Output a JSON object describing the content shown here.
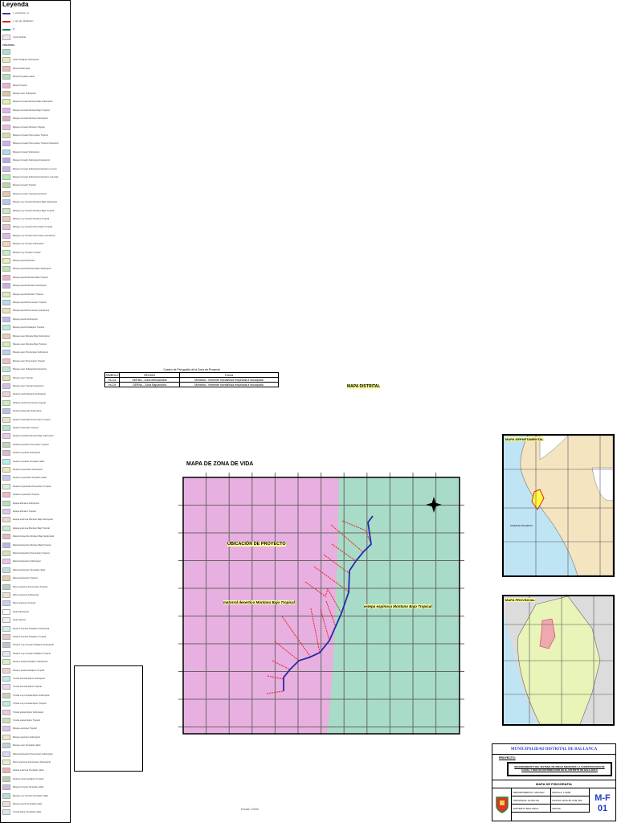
{
  "legend": {
    "title": "Leyenda",
    "lines": [
      {
        "label": "L_conduccion_xx",
        "color": "#3a3aa8",
        "style": "solid"
      },
      {
        "label": "L_red_de_distribucion",
        "color": "#e82020",
        "style": "dashed"
      },
      {
        "label": "R",
        "color": "#1a8a5a",
        "style": "solid"
      },
      {
        "label": "Limite distrital",
        "color": "#f8e0f8",
        "style": "box"
      }
    ],
    "section": "ZONAVIDA",
    "items": [
      [
        "",
        "#a8e0d0"
      ],
      [
        "Arido Subalpino Subtropical",
        "#e8ecb0"
      ],
      [
        "Boreal Subtropical",
        "#f0b8b0"
      ],
      [
        "Boreal Templado calido",
        "#b0e0c0"
      ],
      [
        "Boreal Tropical",
        "#f0b0d8"
      ],
      [
        "Bosque seco Subtropical",
        "#d8c8a0"
      ],
      [
        "Bosque humedo Montano Bajo Subtropical",
        "#e0f0a8"
      ],
      [
        "Bosque humedo Montano Bajo Tropical",
        "#e8b0f0"
      ],
      [
        "Bosque humedo Montano Subtropical",
        "#d8b0c0"
      ],
      [
        "Bosque humedo Montano Tropical",
        "#f0b8e0"
      ],
      [
        "Bosque humedo Premontano Tropical",
        "#d8e0a0"
      ],
      [
        "Bosque humedo Premontano Tropical (transicion)",
        "#c8b0f0"
      ],
      [
        "Bosque humedo Subtropical",
        "#b0d8e8"
      ],
      [
        "Bosque humedo Subtropical (transicion)",
        "#b8a8f0"
      ],
      [
        "Bosque humedo Subtropical (transicion a seco)",
        "#d0b0f0"
      ],
      [
        "Bosque humedo Subtropical (transicion a pluvial)",
        "#b0f0b0"
      ],
      [
        "Bosque humedo Tropical",
        "#b8d8a0"
      ],
      [
        "Bosque humedo Tropical (transicion)",
        "#e0c8b0"
      ],
      [
        "Bosque muy humedo Montano Bajo Subtropical",
        "#b0c8f0"
      ],
      [
        "Bosque muy humedo Montano Bajo Tropical",
        "#c8e8c0"
      ],
      [
        "Bosque muy humedo Montano Tropical",
        "#f0c8b0"
      ],
      [
        "Bosque muy humedo Premontano Tropical",
        "#e8c0d8"
      ],
      [
        "Bosque muy humedo Premontano (transicion)",
        "#e0b8f0"
      ],
      [
        "Bosque muy humedo Subtropical",
        "#f0d8b0"
      ],
      [
        "Bosque muy humedo Tropical",
        "#c0f0c8"
      ],
      [
        "Bosque pluvial Montano",
        "#e8f0b0"
      ],
      [
        "Bosque pluvial Montano Bajo Subtropical",
        "#b8e8b0"
      ],
      [
        "Bosque pluvial Montano Bajo Tropical",
        "#f0b0c8"
      ],
      [
        "Bosque pluvial Montano Subtropical",
        "#c8b0e8"
      ],
      [
        "Bosque pluvial Montano Tropical",
        "#d8f0b0"
      ],
      [
        "Bosque pluvial Premontano Tropical",
        "#b0e0f0"
      ],
      [
        "Bosque pluvial Premontano (transicion)",
        "#f0e0b0"
      ],
      [
        "Bosque pluvial Subtropical",
        "#c0b8f0"
      ],
      [
        "Bosque pluvial Subalpino Tropical",
        "#b0f0e0"
      ],
      [
        "Bosque seco Montano Bajo Subtropical",
        "#e8d0b8"
      ],
      [
        "Bosque seco Montano Bajo Tropical",
        "#d0f0b8"
      ],
      [
        "Bosque seco Premontano Subtropical",
        "#b8d0f0"
      ],
      [
        "Bosque seco Premontano Tropical",
        "#f0c0c0"
      ],
      [
        "Bosque seco Subtropical (transicion)",
        "#c0e8d8"
      ],
      [
        "Bosque seco Tropical",
        "#e0e0b0"
      ],
      [
        "Bosque seco Tropical (transicion)",
        "#d0c0e8"
      ],
      [
        "Desierto arido Montano Subtropical",
        "#f0d0e0"
      ],
      [
        "Desierto arido Premontano Tropical",
        "#c8f0b0"
      ],
      [
        "Desierto desecado Subtropical",
        "#b8c0e8"
      ],
      [
        "Desierto desecado Premontano Tropical",
        "#e8e8c0"
      ],
      [
        "Desierto desecado Tropical",
        "#b0e8c8"
      ],
      [
        "Desierto perarido Montano Bajo Subtropical",
        "#f0c8e8"
      ],
      [
        "Desierto perarido Premontano Tropical",
        "#c0d8b0"
      ],
      [
        "Desierto perarido Subtropical",
        "#d8b8d0"
      ],
      [
        "Desierto perarido Templado calido",
        "#b0f0f0"
      ],
      [
        "Desierto superarido Subtropical",
        "#f0e8b0"
      ],
      [
        "Desierto superarido Templado calido",
        "#c8c8f0"
      ],
      [
        "Desierto superarido Premontano Tropical",
        "#e0f0d0"
      ],
      [
        "Desierto superarido Tropical",
        "#f0b8c0"
      ],
      [
        "Estepa Montano Subtropical",
        "#b8e0b8"
      ],
      [
        "Estepa Montano Tropical",
        "#d8c8f0"
      ],
      [
        "Estepa espinosa Montano Bajo Subtropical",
        "#f0d8c8"
      ],
      [
        "Estepa espinosa Montano Bajo Tropical",
        "#c0f0d0"
      ],
      [
        "Matorral desertico Montano Bajo Subtropical",
        "#e8b8b8"
      ],
      [
        "Matorral desertico Montano Bajo Tropical",
        "#b8b8e8"
      ],
      [
        "Matorral desertico Premontano Tropical",
        "#d0e8b0"
      ],
      [
        "Matorral desertico Subtropical",
        "#f0c0f0"
      ],
      [
        "Matorral desertico Templado calido",
        "#c0e0e0"
      ],
      [
        "Matorral desertico Tropical",
        "#e0d0b0"
      ],
      [
        "Monte espinoso Premontano Tropical",
        "#b0d0c0"
      ],
      [
        "Monte espinoso Subtropical",
        "#f0e0d0"
      ],
      [
        "Monte espinoso Tropical",
        "#c8d0f0"
      ],
      [
        "Nival Subtropical",
        "#ffffff"
      ],
      [
        "Nival Tropical",
        "#f0f0f0"
      ],
      [
        "Paramo humedo Subalpino Subtropical",
        "#d0f0e8"
      ],
      [
        "Paramo humedo Subalpino Tropical",
        "#e8c8c8"
      ],
      [
        "Paramo muy humedo Subalpino Subtropical",
        "#c0c0d8"
      ],
      [
        "Paramo muy humedo Subalpino Tropical",
        "#e0e8f0"
      ],
      [
        "Paramo pluvial Subalpino Subtropical",
        "#d8f0c0"
      ],
      [
        "Paramo pluvial Subalpino Tropical",
        "#f0d0d0"
      ],
      [
        "Tundra humeda Alpino Subtropical",
        "#c0e8f0"
      ],
      [
        "Tundra humeda Alpino Tropical",
        "#e8d8f0"
      ],
      [
        "Tundra muy humeda Alpino Subtropical",
        "#d0d0b8"
      ],
      [
        "Tundra muy humeda Alpino Tropical",
        "#b8f0d8"
      ],
      [
        "Tundra pluvial Alpino Subtropical",
        "#f0c8d8"
      ],
      [
        "Tundra pluvial Alpino Tropical",
        "#c8e0b8"
      ],
      [
        "Bosque espinoso Tropical",
        "#e0c0f0"
      ],
      [
        "Bosque espinoso Subtropical",
        "#f0e8c8"
      ],
      [
        "Bosque seco Templado calido",
        "#b8d8d8"
      ],
      [
        "Matorral desertico Premontano Subtropical",
        "#d8d8f0"
      ],
      [
        "Monte espinoso Premontano Subtropical",
        "#e8f0c8"
      ],
      [
        "Estepa espinosa Templado calido",
        "#f0b0b0"
      ],
      [
        "Desierto arido Subalpino Tropical",
        "#c0c8b0"
      ],
      [
        "Bosque humedo Templado calido",
        "#d0b8e0"
      ],
      [
        "Bosque muy humedo Templado calido",
        "#b0e0d8"
      ],
      [
        "Bosque pluvial Templado calido",
        "#e8e0d8"
      ],
      [
        "Tundra Alpino Templado calido",
        "#d8e8e8"
      ]
    ]
  },
  "table": {
    "caption": "Cuadro de Fisiografia de la Zona de Proyecto",
    "headers": [
      "SIMBOLO",
      "REGION",
      "Forma"
    ],
    "rows": [
      [
        "Vs-Ca",
        "SERNA - Zona Mesoandina",
        "Montaña - Vertiente montañosa empinada a escarpada"
      ],
      [
        "Vs-Ce",
        "SERNA - Zona Bajoandina",
        "Montaña - Vertiente montañosa empinada a escarpada"
      ]
    ]
  },
  "distrital_label": "MAPA DISTRITAL",
  "main_map": {
    "title": "MAPA DE ZONA DE VIDA",
    "project_label": "UBICACIÓN DE PROYECTO",
    "zone_left": "matorral desertico Montano Bajo Tropical",
    "zone_right": "estepa espinosa Montano Bajo Tropical",
    "colors": {
      "left": "#e8b0e0",
      "right": "#a8dcc8",
      "river": "#2a2aa8",
      "branch": "#e82020"
    }
  },
  "scale_text": "Escala 1:9000",
  "insets": {
    "department": "MAPA DEPARTAMENTAL",
    "provincial": "MAPA PROVINCIAL",
    "ocean": "OCEANO PACIFICO"
  },
  "title_block": {
    "municipality": "MUNICIPALIDAD DISTRITAL DE BALLANCA",
    "project_label": "PROYECTO:",
    "project_text": "MEJORAMIENTO DEL SISTEMA DE RIEGO MEDIANTE LA CONSTRUCCION DE CANAL Y RED DE DISTRIBUCION EN EL DISTRITO DE BALLANCA",
    "map_title": "MAPA DE FISIOGRAFIA",
    "fields": [
      "DEPARTAMENTO: ANCASH",
      "ESCALA: 1:9000",
      "PROVINCIA: HUAYLAS",
      "DATUM: WGS 84 UTM 18S",
      "DISTRITO: BALLANCA",
      "FECHA:"
    ],
    "code": "M-F",
    "code_num": "01"
  }
}
